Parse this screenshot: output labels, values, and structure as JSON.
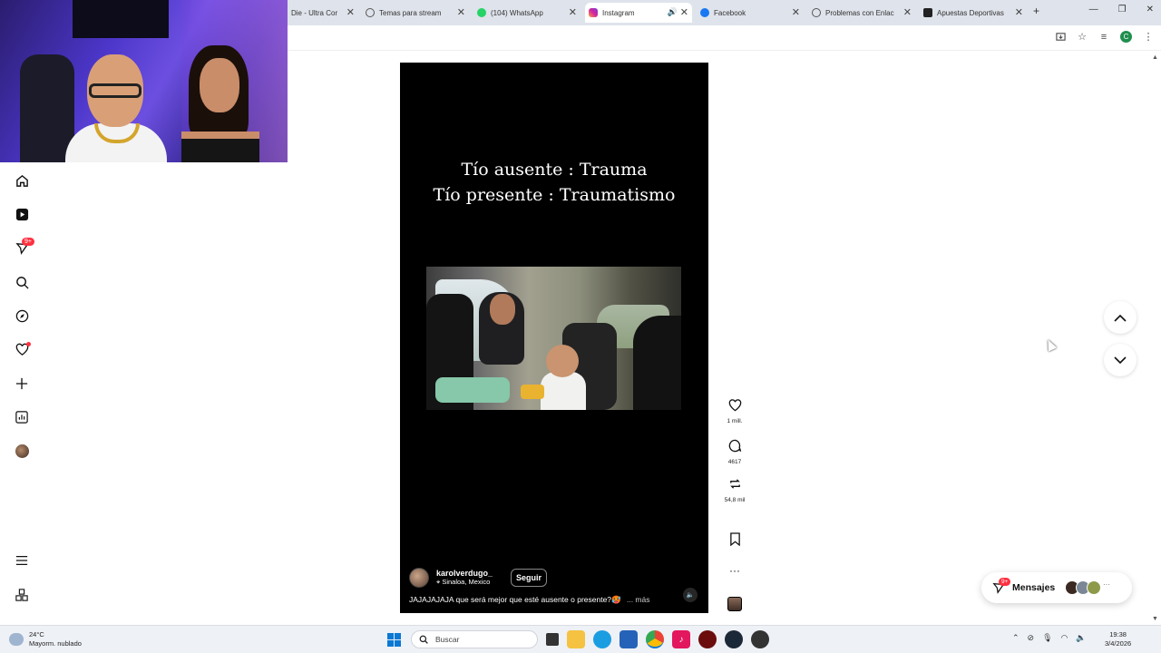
{
  "browser": {
    "tabs": [
      {
        "label": "Die - Ultra Cor",
        "icon": "page-icon"
      },
      {
        "label": "Temas para stream",
        "icon": "chatgpt-icon"
      },
      {
        "label": "(104) WhatsApp",
        "icon": "whatsapp-icon"
      },
      {
        "label": "Instagram",
        "icon": "instagram-icon"
      },
      {
        "label": "Facebook",
        "icon": "facebook-icon"
      },
      {
        "label": "Problemas con Enlac",
        "icon": "chatgpt-icon"
      },
      {
        "label": "Apuestas Deportivas",
        "icon": "page-icon"
      }
    ],
    "profile_initial": "C"
  },
  "reel": {
    "caption_line1": "Tío ausente : Trauma",
    "caption_line2": "Tío presente : Traumatismo",
    "username": "karolverdugo_",
    "location": "Sinaloa, Mexico",
    "follow_label": "Seguir",
    "description": "JAJAJAJAJA que será mejor que esté ausente o presente?🥵",
    "more_label": "... más"
  },
  "actions": {
    "likes": "1 mill.",
    "comments": "4617",
    "shares": "54,8 mil"
  },
  "nav": {
    "notifications_badge": "9+"
  },
  "messages": {
    "label": "Mensajes",
    "badge": "9+"
  },
  "taskbar": {
    "temperature": "24°C",
    "weather": "Mayorm. nublado",
    "search_placeholder": "Buscar",
    "time": "19:38",
    "date": "3/4/2026"
  }
}
